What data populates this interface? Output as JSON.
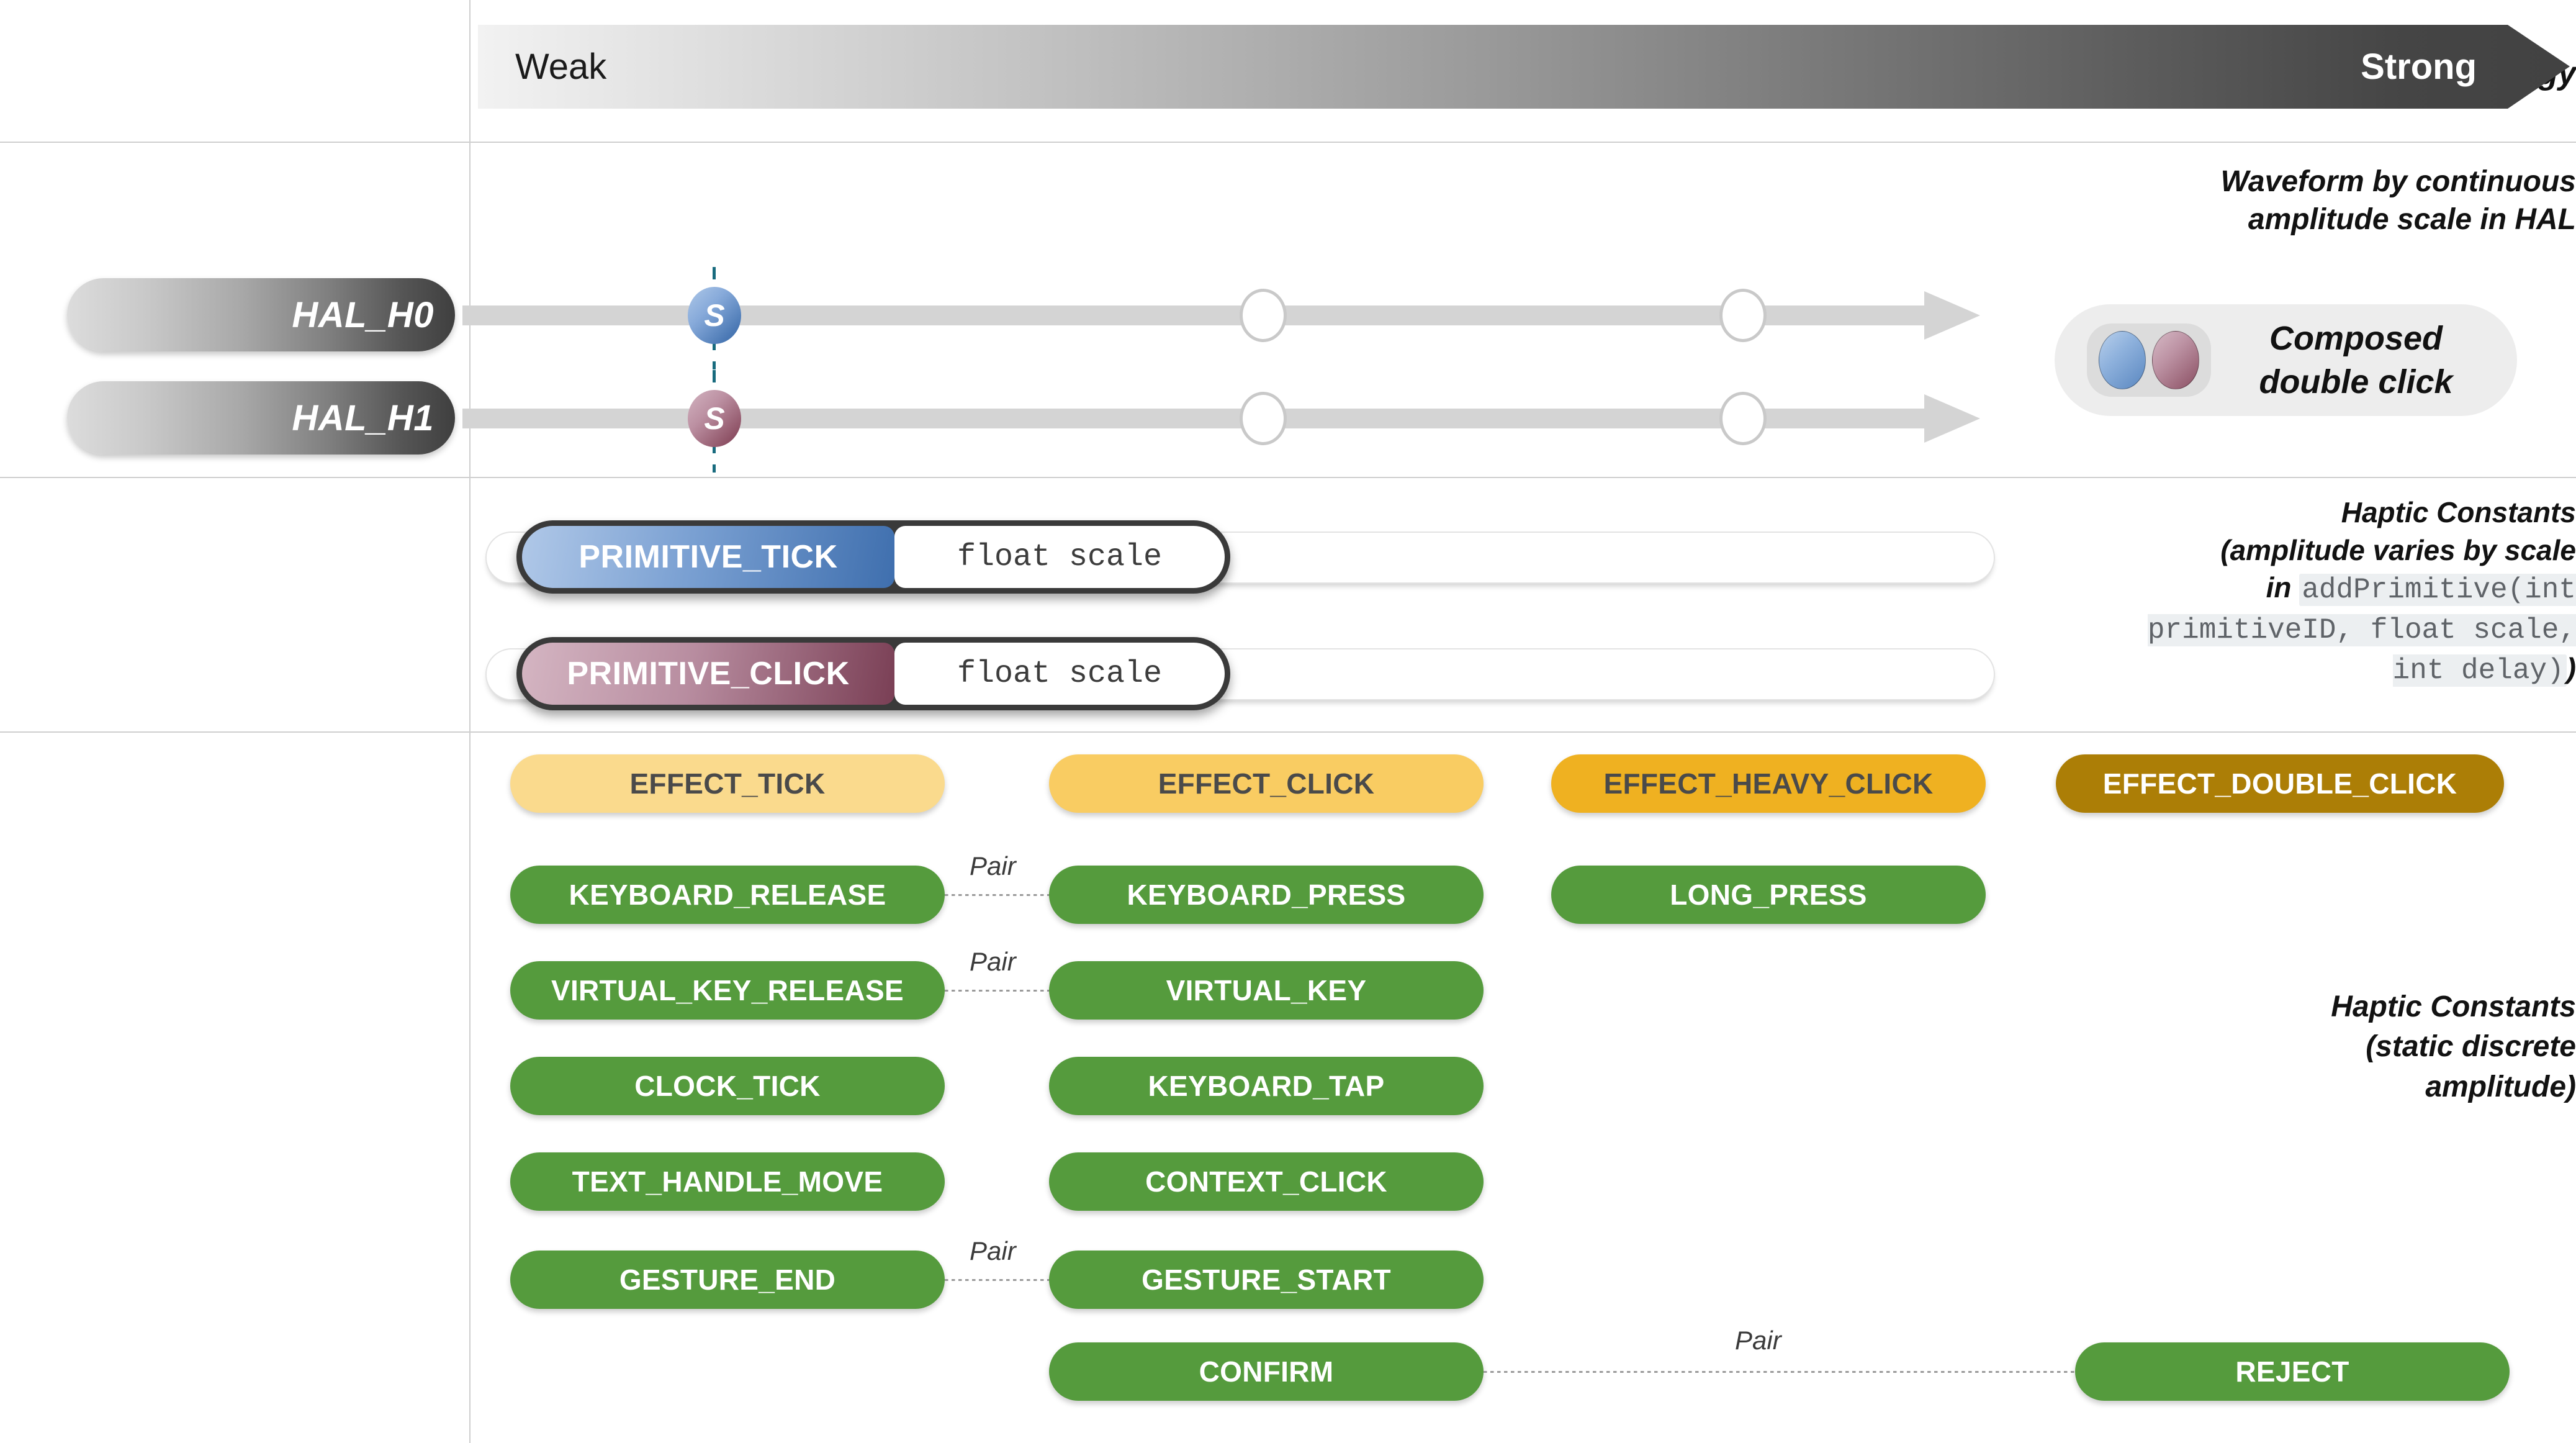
{
  "sections": {
    "conceptual_energy": {
      "label": "Conceptual energy",
      "weak": "Weak",
      "strong": "Strong"
    },
    "waveform": {
      "label_line1": "Waveform by continuous",
      "label_line2": "amplitude scale in HAL",
      "rows": [
        {
          "name": "HAL_H0",
          "marker": "S"
        },
        {
          "name": "HAL_H1",
          "marker": "S"
        }
      ],
      "composed": {
        "line1": "Composed",
        "line2": "double click"
      }
    },
    "primitives": {
      "label_line1": "Haptic Constants",
      "label_line2": "(amplitude varies by scale",
      "label_in": "in ",
      "label_code": "addPrimitive(int primitiveID, float scale, int delay)",
      "label_close": ")",
      "rows": [
        {
          "name": "PRIMITIVE_TICK",
          "param": "float scale"
        },
        {
          "name": "PRIMITIVE_CLICK",
          "param": "float scale"
        }
      ]
    },
    "constants": {
      "label_line1": "Haptic Constants",
      "label_line2": "(static discrete",
      "label_line3": "amplitude)",
      "effects": [
        {
          "name": "EFFECT_TICK",
          "color": "#fada8d",
          "text_color": "#4a4a4a"
        },
        {
          "name": "EFFECT_CLICK",
          "color": "#f9cc62",
          "text_color": "#4a4a4a"
        },
        {
          "name": "EFFECT_HEAVY_CLICK",
          "color": "#efb121",
          "text_color": "#4a4a4a"
        },
        {
          "name": "EFFECT_DOUBLE_CLICK",
          "color": "#ac7e06",
          "text_color": "#ffffff"
        }
      ],
      "rows": [
        {
          "left": "KEYBOARD_RELEASE",
          "mid": "KEYBOARD_PRESS",
          "right": "LONG_PRESS",
          "pair_label": "Pair",
          "pair": "left-mid"
        },
        {
          "left": "VIRTUAL_KEY_RELEASE",
          "mid": "VIRTUAL_KEY",
          "right": "",
          "pair_label": "Pair",
          "pair": "left-mid"
        },
        {
          "left": "CLOCK_TICK",
          "mid": "KEYBOARD_TAP",
          "right": "",
          "pair_label": "",
          "pair": ""
        },
        {
          "left": "TEXT_HANDLE_MOVE",
          "mid": "CONTEXT_CLICK",
          "right": "",
          "pair_label": "",
          "pair": ""
        },
        {
          "left": "GESTURE_END",
          "mid": "GESTURE_START",
          "right": "",
          "pair_label": "Pair",
          "pair": "left-mid"
        },
        {
          "left": "",
          "mid": "CONFIRM",
          "right": "REJECT",
          "pair_label": "Pair",
          "pair": "mid-far"
        }
      ],
      "far_right": "REJECT"
    }
  },
  "colors": {
    "green_pill": "#559b3d",
    "primitive_tick": "#3f6fae",
    "primitive_click": "#7a3f55",
    "rule": "#cfcfcf",
    "track": "#d4d4d4"
  }
}
